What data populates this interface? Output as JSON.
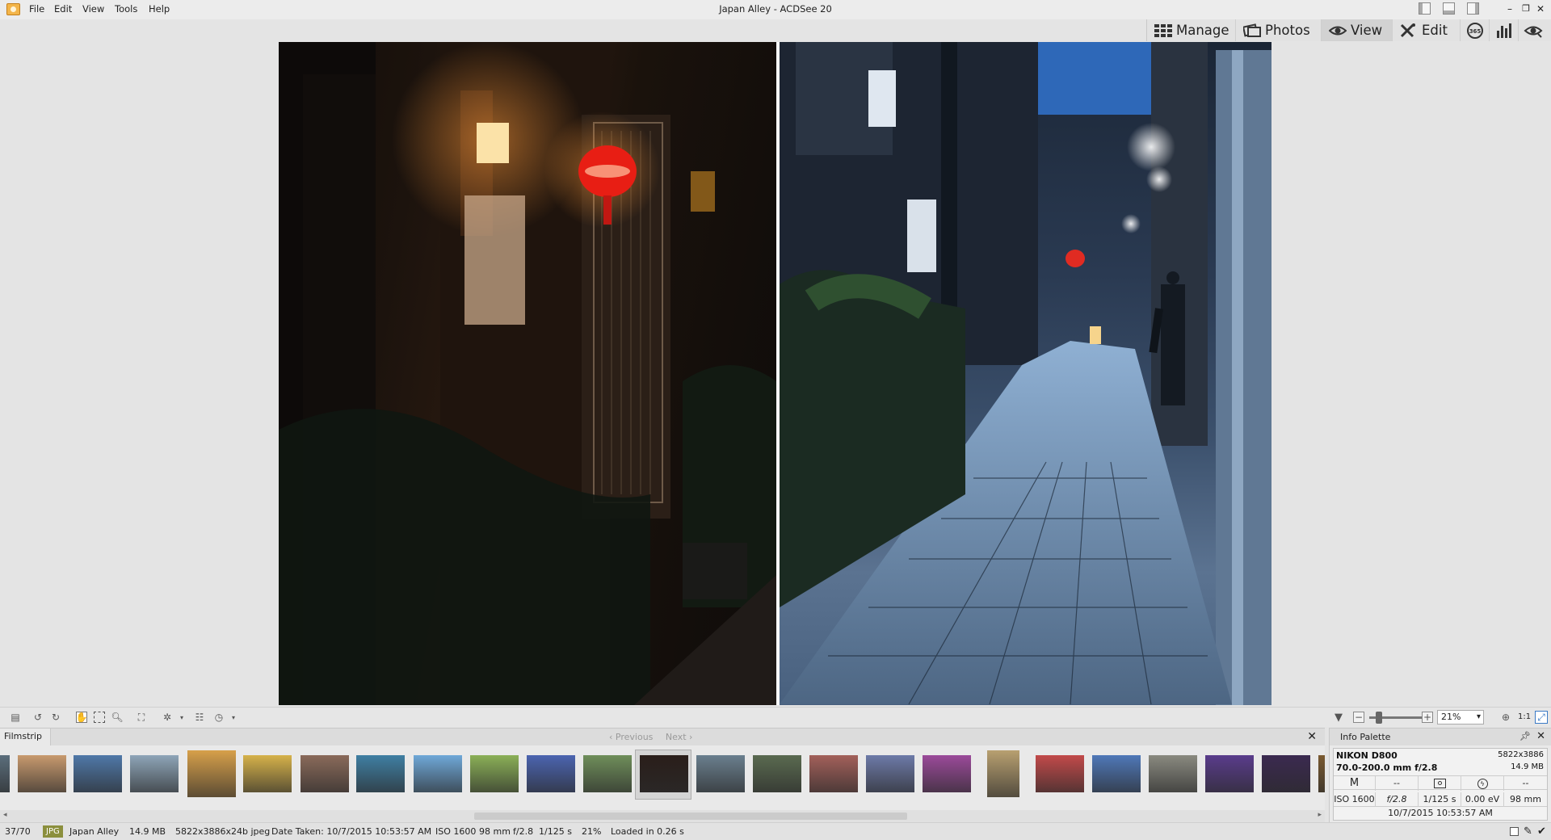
{
  "window": {
    "title": "Japan Alley - ACDSee 20",
    "controls": [
      "minimize",
      "restore",
      "close"
    ]
  },
  "menu": [
    "File",
    "Edit",
    "View",
    "Tools",
    "Help"
  ],
  "modes": [
    {
      "label": "Manage",
      "icon": "grid-icon"
    },
    {
      "label": "Photos",
      "icon": "photos-icon"
    },
    {
      "label": "View",
      "icon": "eye-icon",
      "active": true
    },
    {
      "label": "Edit",
      "icon": "edit-brush-icon"
    }
  ],
  "mode_icons": [
    "365-icon",
    "histogram-icon",
    "eye-settings-icon"
  ],
  "image": {
    "name": "Japan Alley",
    "split_view": true
  },
  "toolbar": {
    "zoom_value": "21%",
    "zoom_slider_level": 0.1,
    "actual_size_label": "1:1"
  },
  "filmstrip": {
    "tab_label": "Filmstrip",
    "previous_label": "Previous",
    "next_label": "Next",
    "thumbnails": [
      {
        "color": "#5b6e7c"
      },
      {
        "color": "#c89a6e"
      },
      {
        "color": "#4f78a8"
      },
      {
        "color": "#8ea5b8"
      },
      {
        "color": "#d7a04a"
      },
      {
        "color": "#d6b24a"
      },
      {
        "color": "#8a6a5a"
      },
      {
        "color": "#3f7fa3"
      },
      {
        "color": "#6fa8d8"
      },
      {
        "color": "#8bb057"
      },
      {
        "color": "#4b64b0"
      },
      {
        "color": "#6f8e5a"
      },
      {
        "color": "#2a1e1a",
        "selected": true
      },
      {
        "color": "#6a7f8e"
      },
      {
        "color": "#5a6a50"
      },
      {
        "color": "#a3605a"
      },
      {
        "color": "#6d7aa8"
      },
      {
        "color": "#9b4a9a"
      },
      {
        "color": "#b8a070"
      },
      {
        "color": "#c24a4a"
      },
      {
        "color": "#4f78b8"
      },
      {
        "color": "#8a8a80"
      },
      {
        "color": "#5a3c8c"
      },
      {
        "color": "#3b2a50"
      },
      {
        "color": "#7a5a30"
      }
    ]
  },
  "info_palette": {
    "title": "Info Palette",
    "camera": "NIKON D800",
    "lens": "70.0-200.0 mm f/2.8",
    "dimensions": "5822x3886",
    "size": "14.9 MB",
    "mode": "M",
    "row1": [
      "M",
      "--",
      "metering-icon",
      "flash-icon",
      "--"
    ],
    "iso": "ISO 1600",
    "aperture": "f/2.8",
    "shutter": "1/125 s",
    "ev": "0.00 eV",
    "focal": "98 mm",
    "date": "10/7/2015 10:53:57 AM"
  },
  "status": {
    "index": "37/70",
    "type": "JPG",
    "name": "Japan Alley",
    "size": "14.9 MB",
    "format": "5822x3886x24b jpeg",
    "date_taken": "Date Taken: 10/7/2015 10:53:57 AM",
    "iso": "ISO 1600",
    "focal": "98 mm",
    "aperture": "f/2.8",
    "shutter": "1/125 s",
    "zoom": "21%",
    "loaded": "Loaded in 0.26 s"
  }
}
